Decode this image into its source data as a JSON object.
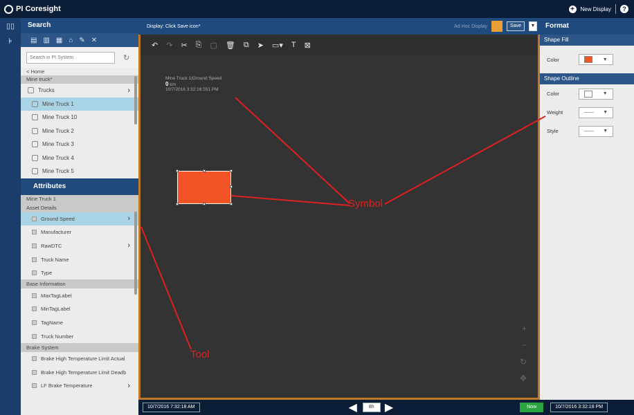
{
  "app": {
    "title": "PI Coresight",
    "new_display": "New Display",
    "help": "?"
  },
  "nav": {
    "title": "Search",
    "search_placeholder": "Search in PI System",
    "breadcrumb_home": "< Home",
    "group_label": "Mine truck*",
    "parent": "Trucks",
    "items": [
      "Mine Truck 1",
      "Mine Truck 10",
      "Mine Truck 2",
      "Mine Truck 3",
      "Mine Truck 4",
      "Mine Truck 5"
    ]
  },
  "attributes": {
    "title": "Attributes",
    "asset": "Mine Truck 1",
    "groups": [
      {
        "name": "Asset Details",
        "items": [
          "Ground Speed",
          "Manufacturer",
          "RawDTC",
          "Truck Name",
          "Type"
        ]
      },
      {
        "name": "Base Information",
        "items": [
          "MaxTagLabel",
          "MinTagLabel",
          "TagName",
          "Truck Number"
        ]
      },
      {
        "name": "Brake System",
        "items": [
          "Brake High Temperature Limit Actual",
          "Brake High Temperature Limit Deadb",
          "LF Brake Temperature"
        ]
      }
    ]
  },
  "display": {
    "label": "Display: Click Save icon*",
    "ad_hoc": "Ad Hoc Display",
    "save": "Save",
    "symbol_title": "Mine Truck 1|Ground Speed",
    "symbol_value": "0",
    "symbol_unit": "km",
    "symbol_time": "10/7/2016 3:32:18.551 PM"
  },
  "timebar": {
    "start": "10/7/2016 7:32:18 AM",
    "duration": "8h",
    "now": "Now",
    "end": "10/7/2016 3:32:18 PM"
  },
  "format": {
    "title": "Format",
    "shape_fill": "Shape Fill",
    "shape_outline": "Shape Outline",
    "color_label": "Color",
    "weight_label": "Weight",
    "style_label": "Style",
    "fill_color": "#f35426",
    "outline_color": "#ffffff"
  },
  "annotations": {
    "symbol": "Symbol",
    "tool": "Tool"
  }
}
